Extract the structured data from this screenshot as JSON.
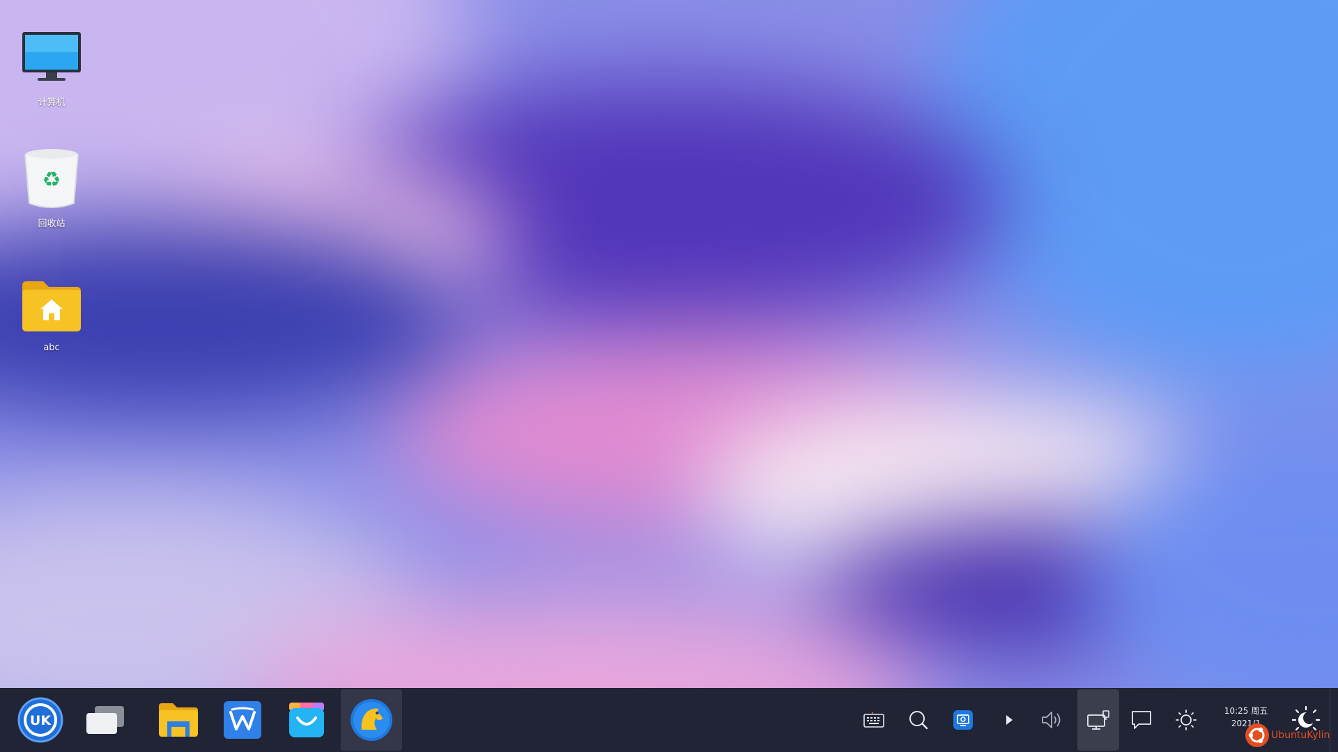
{
  "desktop": {
    "icons": [
      {
        "label": "计算机",
        "icon": "computer-icon"
      },
      {
        "label": "回收站",
        "icon": "trash-icon"
      },
      {
        "label": "abc",
        "icon": "home-folder-icon"
      }
    ]
  },
  "taskbar": {
    "apps": [
      {
        "name": "start-menu",
        "icon": "ukui-start-icon"
      },
      {
        "name": "multitask-view",
        "icon": "multitask-icon"
      },
      {
        "name": "file-manager",
        "icon": "folder-icon"
      },
      {
        "name": "wps",
        "icon": "wps-icon"
      },
      {
        "name": "software-store",
        "icon": "store-bag-icon"
      },
      {
        "name": "browser",
        "icon": "horse-browser-icon",
        "active": true
      }
    ],
    "tray": [
      {
        "name": "keyboard",
        "icon": "keyboard-icon"
      },
      {
        "name": "search",
        "icon": "search-icon"
      },
      {
        "name": "screenshot-tool",
        "icon": "screen-capture-icon"
      },
      {
        "name": "tray-expand",
        "icon": "triangle-right-icon"
      },
      {
        "name": "volume",
        "icon": "volume-icon"
      },
      {
        "name": "network",
        "icon": "network-wired-icon",
        "active": true
      },
      {
        "name": "notifications",
        "icon": "chat-bubble-icon"
      },
      {
        "name": "brightness",
        "icon": "sun-icon"
      },
      {
        "name": "night-mode",
        "icon": "night-mode-icon"
      }
    ],
    "clock": {
      "time": "10:25 周五",
      "date": "2021/1"
    },
    "watermark": "UbuntuKylin"
  },
  "colors": {
    "taskbar_bg": "#202435",
    "accent_blue": "#2f7fe0",
    "watermark": "#e34f21"
  }
}
